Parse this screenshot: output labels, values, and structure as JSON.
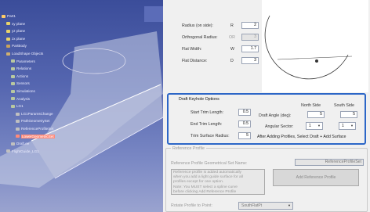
{
  "tree": {
    "items": [
      {
        "label": "Part1",
        "color": "#ffcc66"
      },
      {
        "label": "xy plane",
        "color": "#e8d36a"
      },
      {
        "label": "yz plane",
        "color": "#e8d36a"
      },
      {
        "label": "zx plane",
        "color": "#e8d36a"
      },
      {
        "label": "PartBody",
        "color": "#c9a35c"
      },
      {
        "label": "LoadShape Objects",
        "color": "#d0b070"
      },
      {
        "label": "Parameters",
        "color": "#b8c8a0"
      },
      {
        "label": "Relations",
        "color": "#b8c8a0"
      },
      {
        "label": "Actions",
        "color": "#b8c8a0"
      },
      {
        "label": "Sensors",
        "color": "#b8c8a0"
      },
      {
        "label": "Simulations",
        "color": "#b8c8a0"
      },
      {
        "label": "Analysis",
        "color": "#b8c8a0"
      },
      {
        "label": "LG1",
        "color": "#b8c8a0"
      },
      {
        "label": "LG1ParamsChange",
        "color": "#c0c0c0"
      },
      {
        "label": "PathGeometrySet",
        "color": "#c0c0c0"
      },
      {
        "label": "ReferenceProfileSet",
        "color": "#c0c0c0"
      },
      {
        "label": "LowerGeometricSet",
        "color": "#ff8a7a"
      },
      {
        "label": "Draft.ee",
        "color": "#c0c0c0"
      },
      {
        "label": "FlightGuide_LG1",
        "color": "#c0c0c0"
      }
    ]
  },
  "params": {
    "radius": {
      "label": "Radius (on side):",
      "code": "R",
      "value": "2"
    },
    "orthogonal": {
      "label": "Orthogonal Radius:",
      "code": "OR",
      "value": "3"
    },
    "flat_width": {
      "label": "Flat Width:",
      "code": "W",
      "value": "1.7"
    },
    "flat_distance": {
      "label": "Flat Distance:",
      "code": "D",
      "value": "3"
    }
  },
  "draft": {
    "title": "Draft Keyhole Options",
    "start_trim_label": "Start Trim Length:",
    "start_trim_value": "0.5",
    "end_trim_label": "End Trim Length:",
    "end_trim_value": "0.5",
    "trim_surface_label": "Trim Surface Radius:",
    "trim_surface_value": "5",
    "north_side": "North Side",
    "south_side": "South Side",
    "draft_angle_label": "Draft Angle (deg):",
    "north_angle": "5",
    "south_angle": "5",
    "angular_sector_label": "Angular Sector:",
    "north_sector": "1",
    "south_sector": "1",
    "note": "After Adding Profiles, Select Draft + Add Surface"
  },
  "reference": {
    "title": "Reference Profile",
    "gs_label": "Reference Profile Geometrical Set Name:",
    "gs_value": "ReferenceProfileSet",
    "note": [
      "Reference profile is added automatically",
      "when you add a light guide surface for all",
      "profiles except for one option.",
      "Note: You MUST select a spline curve",
      "before clicking Add Reference Profile"
    ],
    "add_button": "Add Reference Profile",
    "rotate_label": "Rotate Profile to Point:",
    "rotate_value": "SouthFlatPt"
  },
  "colors": {
    "group_border": "#2c66c7",
    "viewport_top": "#3b4d9a",
    "viewport_bottom": "#9aa3cf"
  }
}
